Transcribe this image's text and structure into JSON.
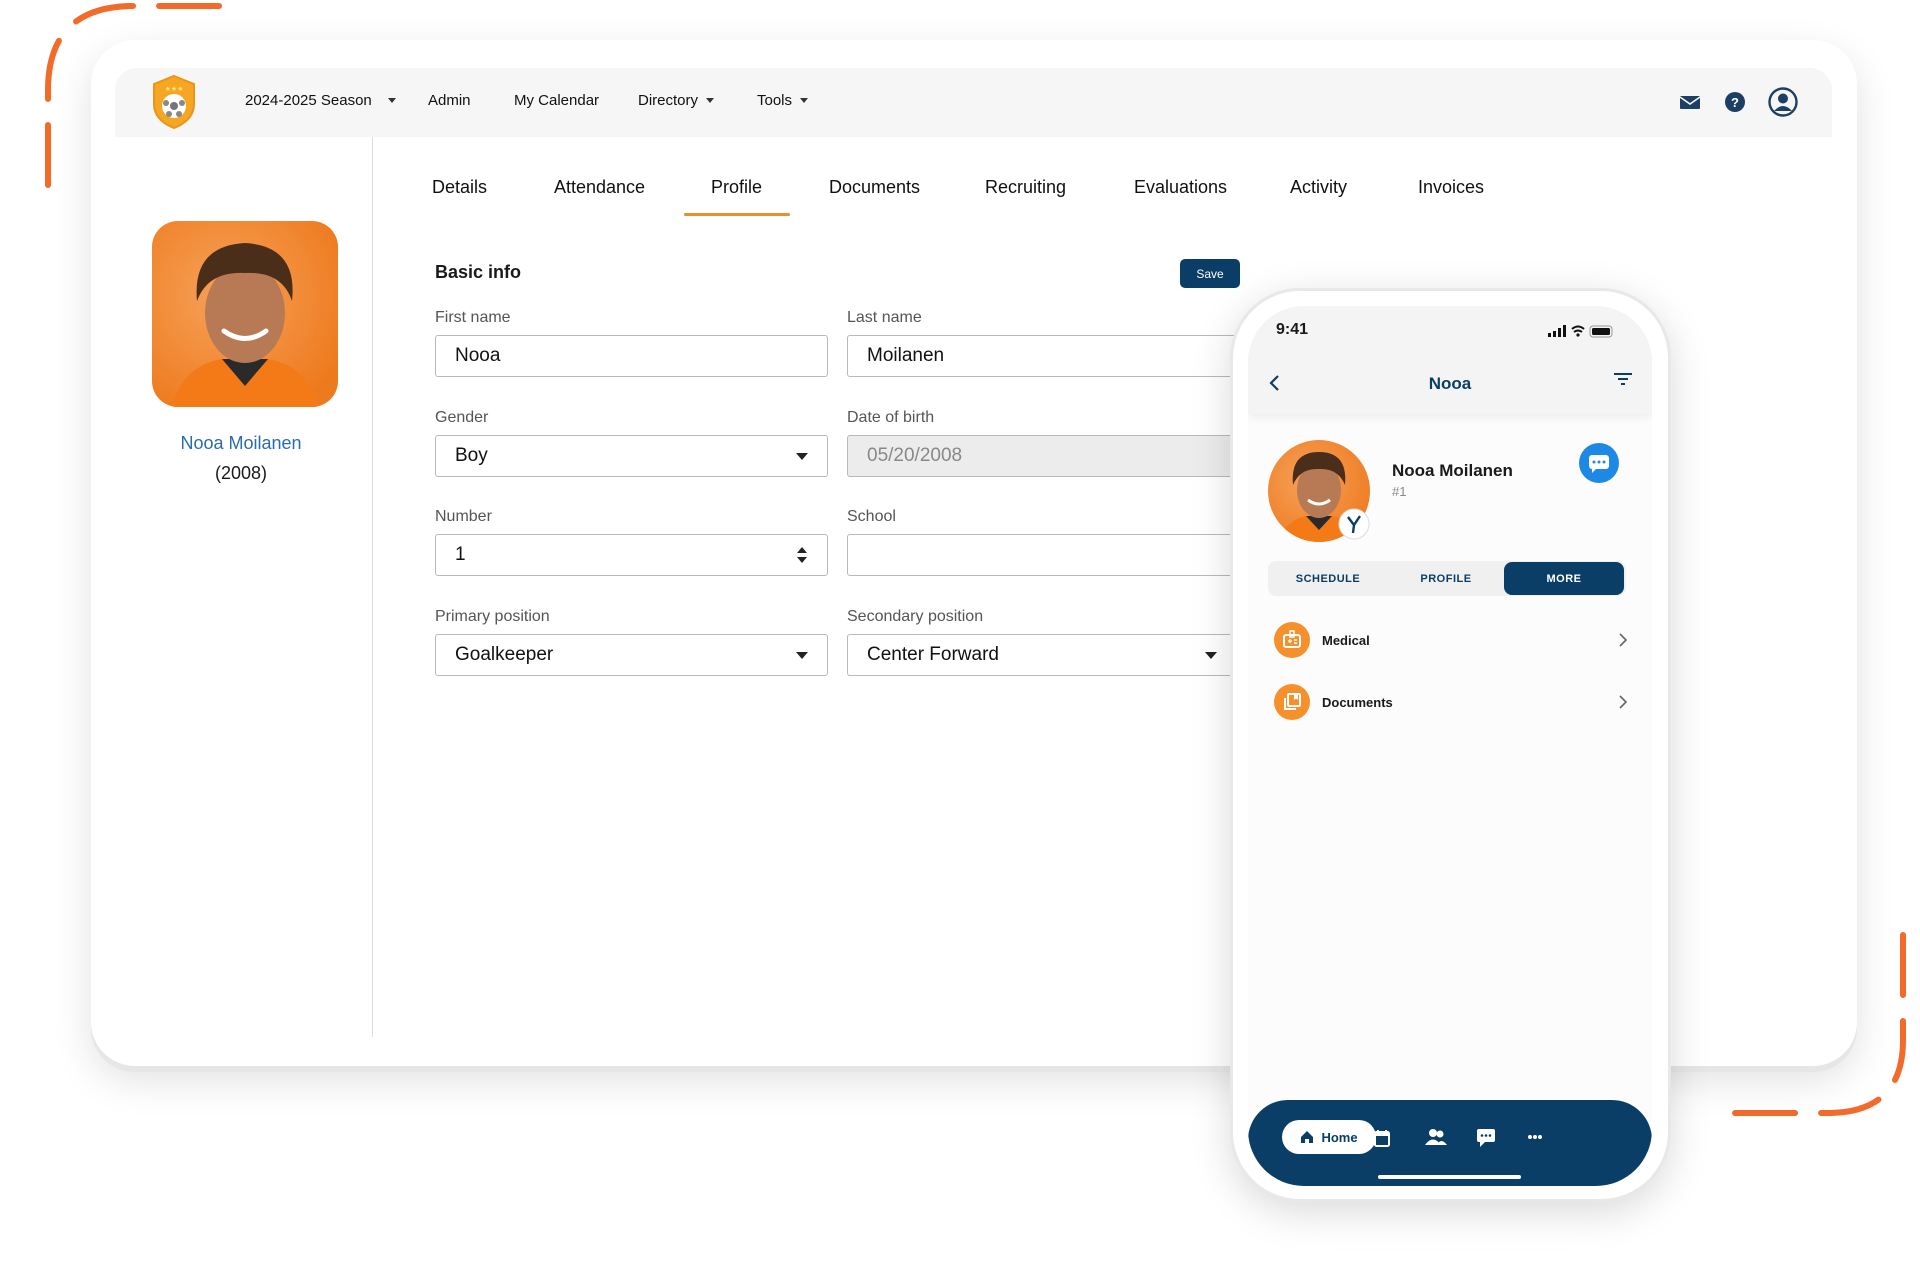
{
  "colors": {
    "accent": "#f28a2e",
    "primary": "#0b3e66",
    "chat": "#1e88e5",
    "decoration": "#f26b2a"
  },
  "navbar": {
    "logo": "team-shield-logo",
    "items": [
      {
        "label": "2024-2025 Season",
        "dropdown": true
      },
      {
        "label": "Admin",
        "dropdown": false
      },
      {
        "label": "My Calendar",
        "dropdown": false
      },
      {
        "label": "Directory",
        "dropdown": true
      },
      {
        "label": "Tools",
        "dropdown": true
      }
    ],
    "icons": [
      "mail-icon",
      "help-icon",
      "user-account-icon"
    ]
  },
  "player": {
    "name": "Nooa Moilanen",
    "year": "(2008)"
  },
  "tabs": [
    {
      "label": "Details"
    },
    {
      "label": "Attendance"
    },
    {
      "label": "Profile",
      "active": true
    },
    {
      "label": "Documents"
    },
    {
      "label": "Recruiting"
    },
    {
      "label": "Evaluations"
    },
    {
      "label": "Activity"
    },
    {
      "label": "Invoices"
    }
  ],
  "form": {
    "title": "Basic info",
    "save_label": "Save",
    "first_name": {
      "label": "First name",
      "value": "Nooa"
    },
    "last_name": {
      "label": "Last name",
      "value": "Moilanen"
    },
    "gender": {
      "label": "Gender",
      "value": "Boy"
    },
    "dob": {
      "label": "Date of birth",
      "value": "05/20/2008"
    },
    "number": {
      "label": "Number",
      "value": "1"
    },
    "school": {
      "label": "School",
      "value": ""
    },
    "primary": {
      "label": "Primary position",
      "value": "Goalkeeper"
    },
    "secondary": {
      "label": "Secondary position",
      "value": "Center Forward"
    }
  },
  "phone": {
    "time": "9:41",
    "title": "Nooa",
    "name": "Nooa Moilanen",
    "number": "#1",
    "segments": [
      {
        "label": "SCHEDULE"
      },
      {
        "label": "PROFILE"
      },
      {
        "label": "MORE",
        "active": true
      }
    ],
    "rows": [
      {
        "label": "Medical",
        "icon": "medical-id-icon"
      },
      {
        "label": "Documents",
        "icon": "documents-icon"
      }
    ],
    "bottom_nav": {
      "home_label": "Home",
      "icons": [
        "calendar-icon",
        "people-icon",
        "chat-icon",
        "more-icon"
      ]
    }
  }
}
